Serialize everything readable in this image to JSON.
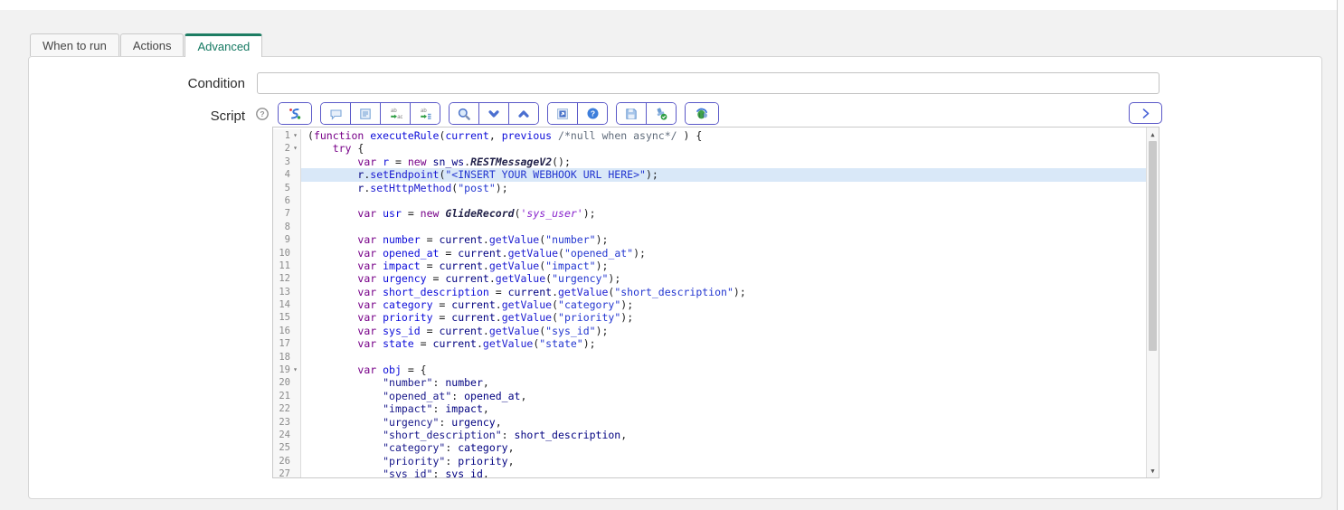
{
  "tabs": [
    {
      "label": "When to run",
      "active": false
    },
    {
      "label": "Actions",
      "active": false
    },
    {
      "label": "Advanced",
      "active": true
    }
  ],
  "form": {
    "condition_label": "Condition",
    "condition_value": "",
    "script_label": "Script"
  },
  "toolbar": {
    "help_icon": "help-icon",
    "groups": [
      {
        "buttons": [
          {
            "icon": "syntax-editor-icon"
          }
        ]
      },
      {
        "buttons": [
          {
            "icon": "toggle-comment-icon"
          },
          {
            "icon": "format-code-icon"
          },
          {
            "icon": "replace-icon"
          },
          {
            "icon": "replace-all-icon"
          }
        ]
      },
      {
        "buttons": [
          {
            "icon": "search-icon"
          },
          {
            "icon": "find-next-icon"
          },
          {
            "icon": "find-previous-icon"
          }
        ]
      },
      {
        "buttons": [
          {
            "icon": "fullscreen-icon"
          },
          {
            "icon": "help-blue-icon"
          }
        ]
      },
      {
        "buttons": [
          {
            "icon": "save-icon"
          },
          {
            "icon": "validate-script-icon"
          }
        ]
      },
      {
        "buttons": [
          {
            "icon": "script-debugger-icon"
          }
        ]
      }
    ],
    "expand_icon": "chevron-right-icon"
  },
  "colors": {
    "accent_green": "#1d7d63",
    "button_border": "#5a58c8",
    "active_line_bg": "#d9e8f8"
  },
  "editor": {
    "active_line": 4,
    "lines": [
      {
        "n": 1,
        "fold": true,
        "tokens": [
          [
            "pln",
            "("
          ],
          [
            "kw",
            "function"
          ],
          [
            "pln",
            " "
          ],
          [
            "def",
            "executeRule"
          ],
          [
            "pln",
            "("
          ],
          [
            "def",
            "current"
          ],
          [
            "pln",
            ", "
          ],
          [
            "def",
            "previous"
          ],
          [
            "pln",
            " "
          ],
          [
            "cmt",
            "/*null when async*/"
          ],
          [
            "pln",
            " ) {"
          ]
        ]
      },
      {
        "n": 2,
        "fold": true,
        "tokens": [
          [
            "pln",
            "    "
          ],
          [
            "kw",
            "try"
          ],
          [
            "pln",
            " {"
          ]
        ]
      },
      {
        "n": 3,
        "tokens": [
          [
            "pln",
            "        "
          ],
          [
            "kw",
            "var"
          ],
          [
            "pln",
            " "
          ],
          [
            "def",
            "r"
          ],
          [
            "pln",
            " = "
          ],
          [
            "kw",
            "new"
          ],
          [
            "pln",
            " "
          ],
          [
            "var",
            "sn_ws"
          ],
          [
            "pln",
            "."
          ],
          [
            "cls",
            "RESTMessageV2"
          ],
          [
            "pln",
            "();"
          ]
        ]
      },
      {
        "n": 4,
        "tokens": [
          [
            "pln",
            "        "
          ],
          [
            "var",
            "r"
          ],
          [
            "pln",
            "."
          ],
          [
            "prop",
            "setEndpoint"
          ],
          [
            "pln",
            "("
          ],
          [
            "str",
            "\"<INSERT YOUR WEBHOOK URL HERE>\""
          ],
          [
            "pln",
            ");"
          ]
        ]
      },
      {
        "n": 5,
        "tokens": [
          [
            "pln",
            "        "
          ],
          [
            "var",
            "r"
          ],
          [
            "pln",
            "."
          ],
          [
            "prop",
            "setHttpMethod"
          ],
          [
            "pln",
            "("
          ],
          [
            "str",
            "\"post\""
          ],
          [
            "pln",
            ");"
          ]
        ]
      },
      {
        "n": 6,
        "tokens": []
      },
      {
        "n": 7,
        "tokens": [
          [
            "pln",
            "        "
          ],
          [
            "kw",
            "var"
          ],
          [
            "pln",
            " "
          ],
          [
            "def",
            "usr"
          ],
          [
            "pln",
            " = "
          ],
          [
            "kw",
            "new"
          ],
          [
            "pln",
            " "
          ],
          [
            "cls",
            "GlideRecord"
          ],
          [
            "pln",
            "("
          ],
          [
            "tbl",
            "'sys_user'"
          ],
          [
            "pln",
            ");"
          ]
        ]
      },
      {
        "n": 8,
        "tokens": []
      },
      {
        "n": 9,
        "tokens": [
          [
            "pln",
            "        "
          ],
          [
            "kw",
            "var"
          ],
          [
            "pln",
            " "
          ],
          [
            "def",
            "number"
          ],
          [
            "pln",
            " = "
          ],
          [
            "var",
            "current"
          ],
          [
            "pln",
            "."
          ],
          [
            "prop",
            "getValue"
          ],
          [
            "pln",
            "("
          ],
          [
            "str",
            "\"number\""
          ],
          [
            "pln",
            ");"
          ]
        ]
      },
      {
        "n": 10,
        "tokens": [
          [
            "pln",
            "        "
          ],
          [
            "kw",
            "var"
          ],
          [
            "pln",
            " "
          ],
          [
            "def",
            "opened_at"
          ],
          [
            "pln",
            " = "
          ],
          [
            "var",
            "current"
          ],
          [
            "pln",
            "."
          ],
          [
            "prop",
            "getValue"
          ],
          [
            "pln",
            "("
          ],
          [
            "str",
            "\"opened_at\""
          ],
          [
            "pln",
            ");"
          ]
        ]
      },
      {
        "n": 11,
        "tokens": [
          [
            "pln",
            "        "
          ],
          [
            "kw",
            "var"
          ],
          [
            "pln",
            " "
          ],
          [
            "def",
            "impact"
          ],
          [
            "pln",
            " = "
          ],
          [
            "var",
            "current"
          ],
          [
            "pln",
            "."
          ],
          [
            "prop",
            "getValue"
          ],
          [
            "pln",
            "("
          ],
          [
            "str",
            "\"impact\""
          ],
          [
            "pln",
            ");"
          ]
        ]
      },
      {
        "n": 12,
        "tokens": [
          [
            "pln",
            "        "
          ],
          [
            "kw",
            "var"
          ],
          [
            "pln",
            " "
          ],
          [
            "def",
            "urgency"
          ],
          [
            "pln",
            " = "
          ],
          [
            "var",
            "current"
          ],
          [
            "pln",
            "."
          ],
          [
            "prop",
            "getValue"
          ],
          [
            "pln",
            "("
          ],
          [
            "str",
            "\"urgency\""
          ],
          [
            "pln",
            ");"
          ]
        ]
      },
      {
        "n": 13,
        "tokens": [
          [
            "pln",
            "        "
          ],
          [
            "kw",
            "var"
          ],
          [
            "pln",
            " "
          ],
          [
            "def",
            "short_description"
          ],
          [
            "pln",
            " = "
          ],
          [
            "var",
            "current"
          ],
          [
            "pln",
            "."
          ],
          [
            "prop",
            "getValue"
          ],
          [
            "pln",
            "("
          ],
          [
            "str",
            "\"short_description\""
          ],
          [
            "pln",
            ");"
          ]
        ]
      },
      {
        "n": 14,
        "tokens": [
          [
            "pln",
            "        "
          ],
          [
            "kw",
            "var"
          ],
          [
            "pln",
            " "
          ],
          [
            "def",
            "category"
          ],
          [
            "pln",
            " = "
          ],
          [
            "var",
            "current"
          ],
          [
            "pln",
            "."
          ],
          [
            "prop",
            "getValue"
          ],
          [
            "pln",
            "("
          ],
          [
            "str",
            "\"category\""
          ],
          [
            "pln",
            ");"
          ]
        ]
      },
      {
        "n": 15,
        "tokens": [
          [
            "pln",
            "        "
          ],
          [
            "kw",
            "var"
          ],
          [
            "pln",
            " "
          ],
          [
            "def",
            "priority"
          ],
          [
            "pln",
            " = "
          ],
          [
            "var",
            "current"
          ],
          [
            "pln",
            "."
          ],
          [
            "prop",
            "getValue"
          ],
          [
            "pln",
            "("
          ],
          [
            "str",
            "\"priority\""
          ],
          [
            "pln",
            ");"
          ]
        ]
      },
      {
        "n": 16,
        "tokens": [
          [
            "pln",
            "        "
          ],
          [
            "kw",
            "var"
          ],
          [
            "pln",
            " "
          ],
          [
            "def",
            "sys_id"
          ],
          [
            "pln",
            " = "
          ],
          [
            "var",
            "current"
          ],
          [
            "pln",
            "."
          ],
          [
            "prop",
            "getValue"
          ],
          [
            "pln",
            "("
          ],
          [
            "str",
            "\"sys_id\""
          ],
          [
            "pln",
            ");"
          ]
        ]
      },
      {
        "n": 17,
        "tokens": [
          [
            "pln",
            "        "
          ],
          [
            "kw",
            "var"
          ],
          [
            "pln",
            " "
          ],
          [
            "def",
            "state"
          ],
          [
            "pln",
            " = "
          ],
          [
            "var",
            "current"
          ],
          [
            "pln",
            "."
          ],
          [
            "prop",
            "getValue"
          ],
          [
            "pln",
            "("
          ],
          [
            "str",
            "\"state\""
          ],
          [
            "pln",
            ");"
          ]
        ]
      },
      {
        "n": 18,
        "tokens": []
      },
      {
        "n": 19,
        "fold": true,
        "tokens": [
          [
            "pln",
            "        "
          ],
          [
            "kw",
            "var"
          ],
          [
            "pln",
            " "
          ],
          [
            "def",
            "obj"
          ],
          [
            "pln",
            " = {"
          ]
        ]
      },
      {
        "n": 20,
        "tokens": [
          [
            "pln",
            "            "
          ],
          [
            "strp",
            "\"number\""
          ],
          [
            "pln",
            ": "
          ],
          [
            "var",
            "number"
          ],
          [
            "pln",
            ","
          ]
        ]
      },
      {
        "n": 21,
        "tokens": [
          [
            "pln",
            "            "
          ],
          [
            "strp",
            "\"opened_at\""
          ],
          [
            "pln",
            ": "
          ],
          [
            "var",
            "opened_at"
          ],
          [
            "pln",
            ","
          ]
        ]
      },
      {
        "n": 22,
        "tokens": [
          [
            "pln",
            "            "
          ],
          [
            "strp",
            "\"impact\""
          ],
          [
            "pln",
            ": "
          ],
          [
            "var",
            "impact"
          ],
          [
            "pln",
            ","
          ]
        ]
      },
      {
        "n": 23,
        "tokens": [
          [
            "pln",
            "            "
          ],
          [
            "strp",
            "\"urgency\""
          ],
          [
            "pln",
            ": "
          ],
          [
            "var",
            "urgency"
          ],
          [
            "pln",
            ","
          ]
        ]
      },
      {
        "n": 24,
        "tokens": [
          [
            "pln",
            "            "
          ],
          [
            "strp",
            "\"short_description\""
          ],
          [
            "pln",
            ": "
          ],
          [
            "var",
            "short_description"
          ],
          [
            "pln",
            ","
          ]
        ]
      },
      {
        "n": 25,
        "tokens": [
          [
            "pln",
            "            "
          ],
          [
            "strp",
            "\"category\""
          ],
          [
            "pln",
            ": "
          ],
          [
            "var",
            "category"
          ],
          [
            "pln",
            ","
          ]
        ]
      },
      {
        "n": 26,
        "tokens": [
          [
            "pln",
            "            "
          ],
          [
            "strp",
            "\"priority\""
          ],
          [
            "pln",
            ": "
          ],
          [
            "var",
            "priority"
          ],
          [
            "pln",
            ","
          ]
        ]
      },
      {
        "n": 27,
        "tokens": [
          [
            "pln",
            "            "
          ],
          [
            "strp",
            "\"sys_id\""
          ],
          [
            "pln",
            ": "
          ],
          [
            "var",
            "sys_id"
          ],
          [
            "pln",
            ","
          ]
        ]
      }
    ]
  }
}
